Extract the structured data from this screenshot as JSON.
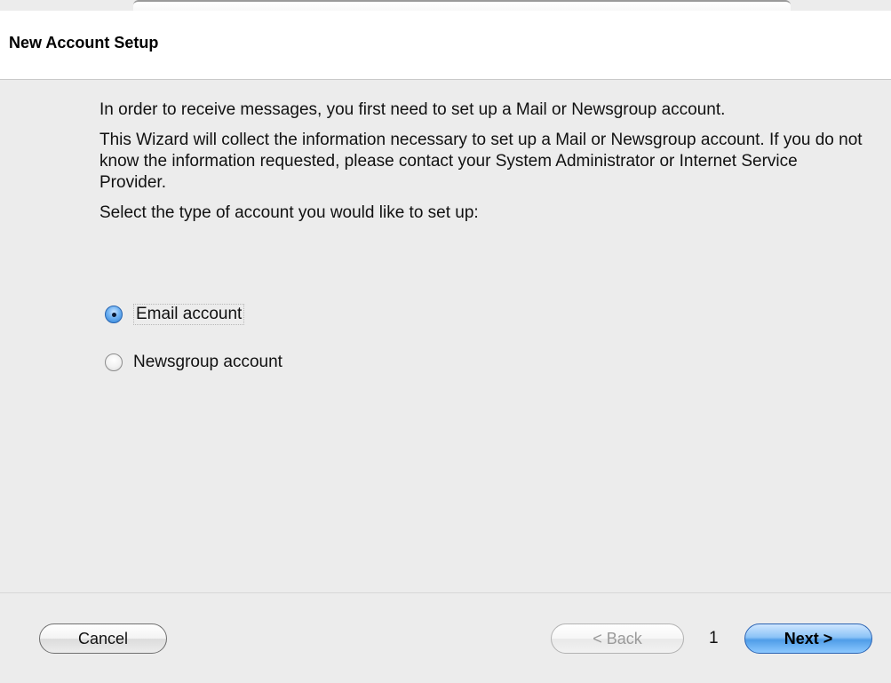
{
  "window": {
    "title": "New Account Setup"
  },
  "intro": {
    "paragraph1": "In order to receive messages, you first need to set up a Mail or Newsgroup account.",
    "paragraph2": "This Wizard will collect the information necessary to set up a Mail or Newsgroup account. If you do not know the information requested, please contact your System Administrator or Internet Service Provider.",
    "prompt": "Select the type of account you would like to set up:"
  },
  "account_type": {
    "selected": "Email account",
    "options": [
      {
        "label": "Email account",
        "checked": true
      },
      {
        "label": "Newsgroup account",
        "checked": false
      }
    ]
  },
  "footer": {
    "cancel_label": "Cancel",
    "back_label": "< Back",
    "page_number": "1",
    "next_label": "Next >",
    "back_enabled": false
  },
  "colors": {
    "window_background": "#ececec",
    "header_background": "#ffffff",
    "accent_blue": "#4f9de8",
    "disabled_text": "#9a9a9a"
  }
}
